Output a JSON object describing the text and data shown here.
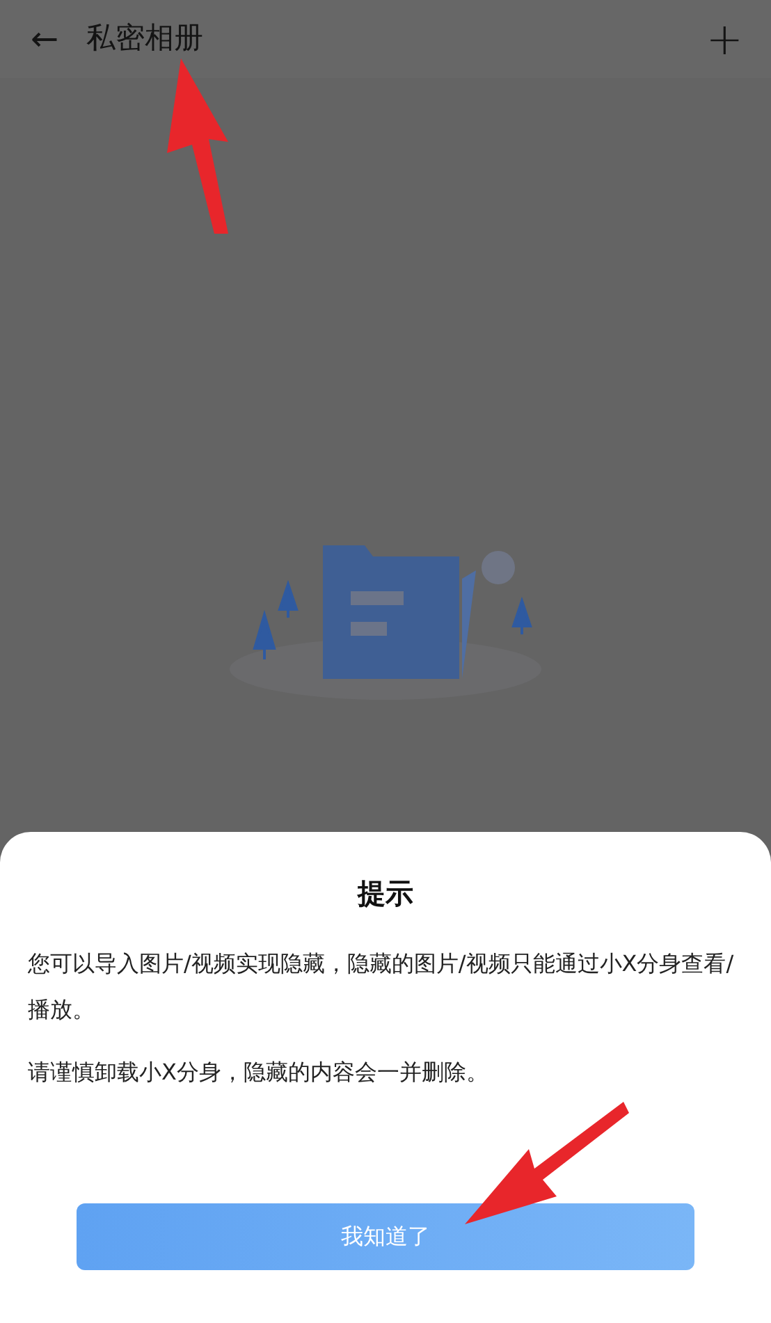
{
  "header": {
    "back": "←",
    "title": "私密相册",
    "add": "+"
  },
  "dialog": {
    "title": "提示",
    "paragraphs": [
      "您可以导入图片/视频实现隐藏，隐藏的图片/视频只能通过小X分身查看/播放。",
      "请谨慎卸载小X分身，隐藏的内容会一并删除。"
    ],
    "button": "我知道了"
  }
}
